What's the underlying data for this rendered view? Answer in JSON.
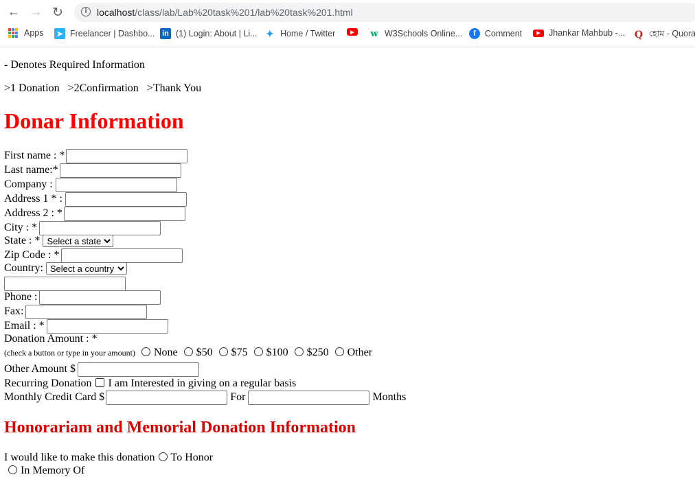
{
  "browser": {
    "url_host": "localhost",
    "url_path": "/class/lab/Lab%20task%201/lab%20task%201.html",
    "bookmarks": [
      {
        "label": "Apps",
        "icon": "apps-grid-icon",
        "color": "#4285f4"
      },
      {
        "label": "Freelancer | Dashbo...",
        "icon": "freelancer-icon",
        "color": "#29b2fe"
      },
      {
        "label": "(1) Login: About | Li...",
        "icon": "linkedin-icon",
        "color": "#0a66c2"
      },
      {
        "label": "Home / Twitter",
        "icon": "twitter-icon",
        "color": "#1da1f2"
      },
      {
        "label": "",
        "icon": "youtube-icon",
        "color": "#ff0000"
      },
      {
        "label": "W3Schools Online...",
        "icon": "w3schools-icon",
        "color": "#04aa6d"
      },
      {
        "label": "Comment",
        "icon": "facebook-icon",
        "color": "#1877f2"
      },
      {
        "label": "Jhankar Mahbub -...",
        "icon": "youtube-icon",
        "color": "#ff0000"
      },
      {
        "label": "হোম - Quora",
        "icon": "quora-icon",
        "color": "#b92b27"
      }
    ]
  },
  "page": {
    "required_note": "- Denotes Required Information",
    "steps": ">1 Donation   >2Confirmation   >Thank You",
    "title": "Donar Information",
    "fields": {
      "first_name": "First name : *",
      "last_name": "Last name:*",
      "company": "Company :",
      "address1": "Address 1 * :",
      "address2": "Address 2 : *",
      "city": "City : *",
      "state": "State : *",
      "state_select": "Select a state",
      "zip": "Zip Code : *",
      "country": "Country:",
      "country_select": "Select a country",
      "phone": "Phone :",
      "fax": "Fax:",
      "email": "Email : *",
      "donation_amount": "Donation Amount : *",
      "donation_hint": "(check a button or type in your amount)",
      "amount_options": [
        "None",
        "$50",
        "$75",
        "$100",
        "$250",
        "Other"
      ],
      "other_amount": "Other Amount $",
      "recurring": "Recurring Donation",
      "recurring_check": "I am Interested in giving on a regular basis",
      "monthly": "Monthly Credit Card $",
      "for": "For",
      "months": "Months"
    },
    "section2_title": "Honorariam and Memorial Donation Information",
    "donation_for": "I would like to make this donation",
    "to_honor": "To Honor",
    "in_memory": "In Memory Of"
  }
}
